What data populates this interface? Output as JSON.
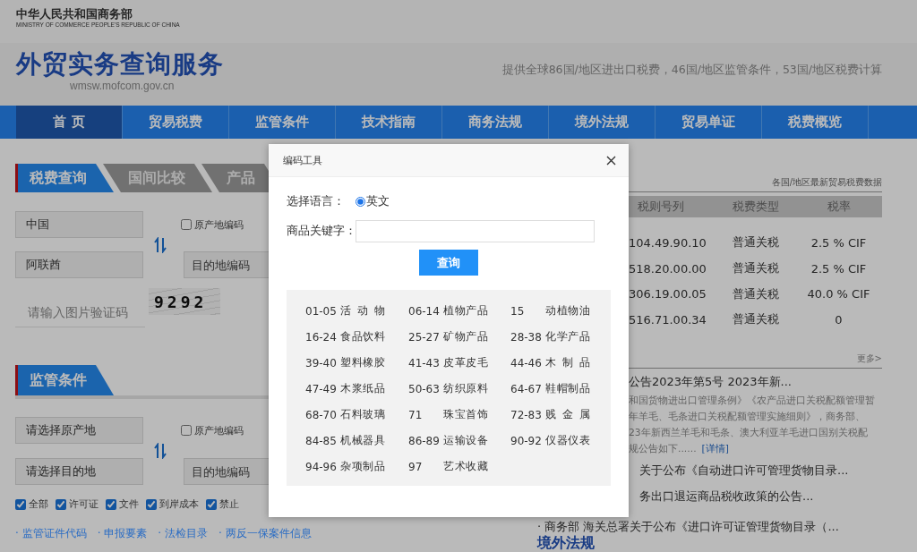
{
  "ministry": {
    "name": "中华人民共和国商务部",
    "name_en": "MINISTRY OF COMMERCE PEOPLE'S REPUBLIC OF CHINA"
  },
  "site": {
    "title": "外贸实务查询服务",
    "url": "wmsw.mofcom.gov.cn",
    "tagline": "提供全球86国/地区进出口税费，46国/地区监管条件，53国/地区税费计算"
  },
  "nav": [
    {
      "label": "首 页",
      "selected": true
    },
    {
      "label": "贸易税费",
      "selected": false
    },
    {
      "label": "监管条件",
      "selected": false
    },
    {
      "label": "技术指南",
      "selected": false
    },
    {
      "label": "商务法规",
      "selected": false
    },
    {
      "label": "境外法规",
      "selected": false
    },
    {
      "label": "贸易单证",
      "selected": false
    },
    {
      "label": "税费概览",
      "selected": false
    }
  ],
  "tax_query": {
    "tabs": [
      {
        "label": "税费查询",
        "selected": true
      },
      {
        "label": "国间比较",
        "selected": false
      },
      {
        "label": "产品",
        "selected": false
      }
    ],
    "origin": {
      "value": "中国"
    },
    "origin_code": {
      "label": "原产地编码",
      "checked": false
    },
    "destination": {
      "value": "阿联酋"
    },
    "destination_code": {
      "placeholder": "目的地编码"
    },
    "captcha_input": {
      "placeholder": "请输入图片验证码"
    },
    "captcha": "9292"
  },
  "regulation": {
    "tabs": [
      {
        "label": "监管条件",
        "selected": true
      }
    ],
    "origin": {
      "value": "请选择原产地"
    },
    "origin_code": {
      "label": "原产地编码",
      "checked": false
    },
    "destination": {
      "value": "请选择目的地"
    },
    "destination_code": {
      "placeholder": "目的地编码"
    },
    "filters": [
      {
        "label": "全部",
        "checked": true
      },
      {
        "label": "许可证",
        "checked": true
      },
      {
        "label": "文件",
        "checked": true
      },
      {
        "label": "到岸成本",
        "checked": true
      },
      {
        "label": "禁止",
        "checked": true
      }
    ],
    "links": [
      "· 监管证件代码",
      "· 申报要素",
      "· 法检目录",
      "· 两反一保案件信息"
    ]
  },
  "tariff_data": {
    "caption": "各国/地区最新贸易税费数据",
    "columns": [
      "税则号列",
      "税费类型",
      "税率"
    ],
    "rows": [
      [
        "104.49.90.10",
        "普通关税",
        "2.5 % CIF"
      ],
      [
        "518.20.00.00",
        "普通关税",
        "2.5 % CIF"
      ],
      [
        "306.19.00.05",
        "普通关税",
        "40.0 % CIF"
      ],
      [
        "516.71.00.34",
        "普通关税",
        "0"
      ]
    ],
    "more": "更多>"
  },
  "news": {
    "title": "公告2023年第5号 2023年新...",
    "excerpt_lines": [
      "和国货物进出口管理条例》《农产品进口关税配额管理暂",
      "年羊毛、毛条进口关税配额管理实施细则》，商务部、",
      "23年新西兰羊毛和毛条、澳大利亚羊毛进口国别关税配",
      "规公告如下......"
    ],
    "detail_link": "[详情]",
    "items": [
      "关于公布《自动进口许可管理货物目录...",
      "务出口退运商品税收政策的公告..."
    ],
    "last_item": "· 商务部 海关总署关于公布《进口许可证管理货物目录（...",
    "next_section": "境外法规"
  },
  "dialog": {
    "title": "编码工具",
    "language_label": "选择语言：",
    "languages": [
      {
        "label": "英文",
        "selected": true
      }
    ],
    "keyword_label": "商品关键字：",
    "search_button": "查询",
    "chapters": [
      {
        "code": "01-05",
        "name": "活 动 物"
      },
      {
        "code": "06-14",
        "name": "植物产品"
      },
      {
        "code": "15",
        "name": "动植物油"
      },
      {
        "code": "16-24",
        "name": "食品饮料"
      },
      {
        "code": "25-27",
        "name": "矿物产品"
      },
      {
        "code": "28-38",
        "name": "化学产品"
      },
      {
        "code": "39-40",
        "name": "塑料橡胶"
      },
      {
        "code": "41-43",
        "name": "皮革皮毛"
      },
      {
        "code": "44-46",
        "name": "木 制 品"
      },
      {
        "code": "47-49",
        "name": "木浆纸品"
      },
      {
        "code": "50-63",
        "name": "纺织原料"
      },
      {
        "code": "64-67",
        "name": "鞋帽制品"
      },
      {
        "code": "68-70",
        "name": "石料玻璃"
      },
      {
        "code": "71",
        "name": "珠宝首饰"
      },
      {
        "code": "72-83",
        "name": "贱 金 属"
      },
      {
        "code": "84-85",
        "name": "机械器具"
      },
      {
        "code": "86-89",
        "name": "运输设备"
      },
      {
        "code": "90-92",
        "name": "仪器仪表"
      },
      {
        "code": "94-96",
        "name": "杂项制品"
      },
      {
        "code": "97",
        "name": "艺术收藏"
      }
    ]
  }
}
